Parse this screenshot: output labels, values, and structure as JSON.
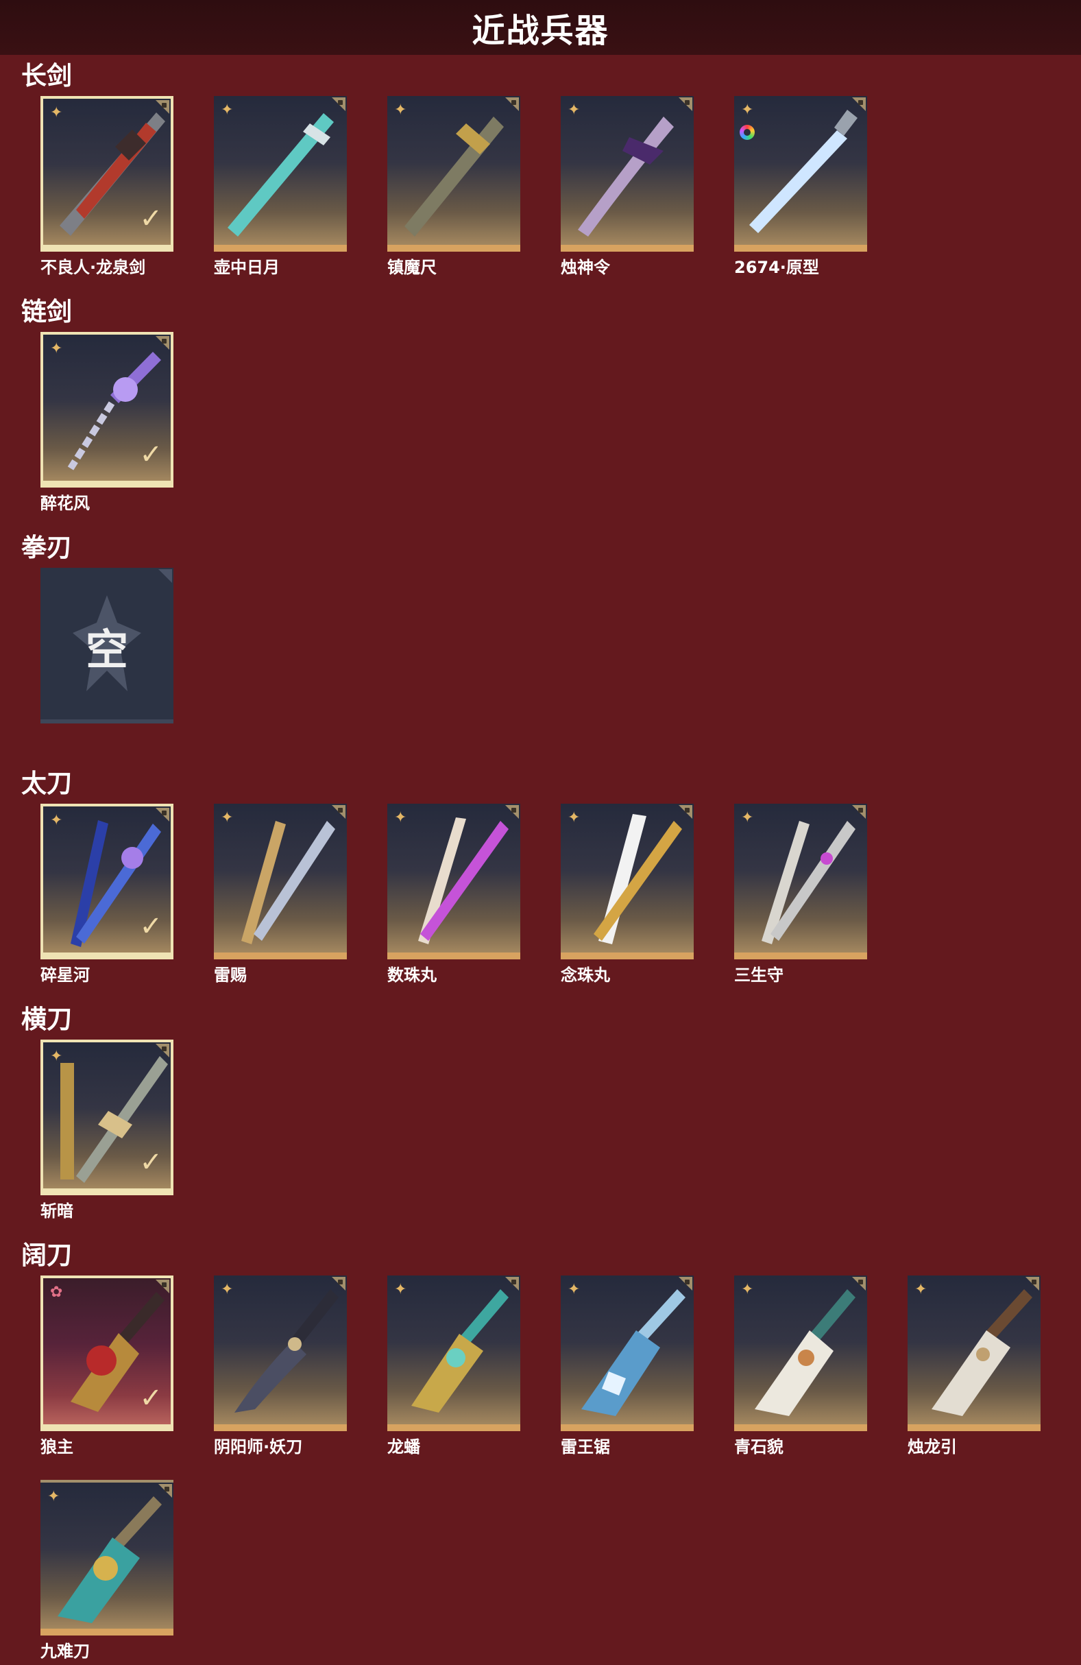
{
  "header": {
    "title": "近战兵器"
  },
  "sections": [
    {
      "title": "长剑",
      "items": [
        {
          "name": "不良人·龙泉剑",
          "badge": "✦",
          "selected": true
        },
        {
          "name": "壶中日月",
          "badge": "✦",
          "selected": false
        },
        {
          "name": "镇魔尺",
          "badge": "✦",
          "selected": false
        },
        {
          "name": "烛神令",
          "badge": "✦",
          "selected": false
        },
        {
          "name": "2674·原型",
          "badge": "✦",
          "selected": false
        }
      ]
    },
    {
      "title": "链剑",
      "items": [
        {
          "name": "醉花风",
          "badge": "✦",
          "selected": true
        }
      ]
    },
    {
      "title": "拳刃",
      "items": [
        {
          "name": "",
          "empty_label": "空"
        }
      ]
    },
    {
      "title": "太刀",
      "items": [
        {
          "name": "碎星河",
          "badge": "✦",
          "selected": true
        },
        {
          "name": "雷赐",
          "badge": "✦",
          "selected": false
        },
        {
          "name": "数珠丸",
          "badge": "✦",
          "selected": false
        },
        {
          "name": "念珠丸",
          "badge": "✦",
          "selected": false
        },
        {
          "name": "三生守",
          "badge": "✦",
          "selected": false
        }
      ]
    },
    {
      "title": "横刀",
      "items": [
        {
          "name": "斩暗",
          "badge": "✦",
          "selected": true
        }
      ]
    },
    {
      "title": "阔刀",
      "items": [
        {
          "name": "狼主",
          "badge": "✿",
          "selected": true
        },
        {
          "name": "阴阳师·妖刀",
          "badge": "✦",
          "selected": false
        },
        {
          "name": "龙蟠",
          "badge": "✦",
          "selected": false
        },
        {
          "name": "雷王锯",
          "badge": "✦",
          "selected": false
        },
        {
          "name": "青石貌",
          "badge": "✦",
          "selected": false
        },
        {
          "name": "烛龙引",
          "badge": "✦",
          "selected": false
        },
        {
          "name": "九难刀",
          "badge": "✦",
          "selected": false
        }
      ]
    }
  ],
  "check_glyph": "✓"
}
